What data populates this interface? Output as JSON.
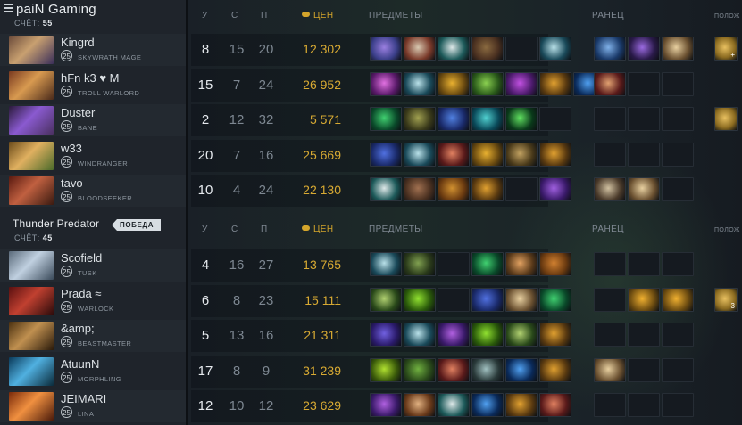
{
  "teams": [
    {
      "name": "paiN Gaming",
      "score_label": "СЧЁТ:",
      "score": "55",
      "victory_label": "",
      "headers": {
        "k": "У",
        "d": "С",
        "a": "П",
        "gold": "ЦЕН",
        "items": "ПРЕДМЕТЫ",
        "backpack": "РАНЕЦ",
        "neutral": "ПОЛОЖ"
      },
      "players": [
        {
          "name": "Kingrd",
          "level": "25",
          "hero": "SKYWRATH MAGE",
          "k": "8",
          "d": "15",
          "a": "20",
          "gold": "12 302",
          "portrait": [
            "#6a4a3a",
            "#c8a070",
            "#3b2f5a"
          ],
          "items": [
            [
              "#3b3f8a",
              "#9a7fe0"
            ],
            [
              "#7a3a2a",
              "#d8c8b0"
            ],
            [
              "#1d5a5a",
              "#dde8e8"
            ],
            [
              "#4a3020",
              "#8a6a40"
            ],
            null,
            [
              "#1a4a5a",
              "#b8e0e8"
            ]
          ],
          "backpack": [
            [
              "#1a3a6a",
              "#7fb0e8"
            ],
            [
              "#2a1a4a",
              "#9a6ae0"
            ],
            [
              "#6a5030",
              "#e8d0a0"
            ]
          ],
          "neutral": [
            "#8a6a20",
            "#e8c060"
          ],
          "neutral_plus": "+"
        },
        {
          "name": "hFn k3 ♥ M",
          "level": "25",
          "hero": "TROLL WARLORD",
          "k": "15",
          "d": "7",
          "a": "24",
          "gold": "26 952",
          "portrait": [
            "#7a3a20",
            "#d89a50",
            "#4a2a1a"
          ],
          "items": [
            [
              "#5a1a6a",
              "#e070e0"
            ],
            [
              "#1a4a5a",
              "#b8e0e8"
            ],
            [
              "#6a4a10",
              "#e8b030"
            ],
            [
              "#2a5a1a",
              "#8ad050"
            ],
            [
              "#4a1a6a",
              "#c050e0"
            ],
            [
              "#5a3a10",
              "#e0a030"
            ],
            [
              "#0a2a5a",
              "#50a0f0"
            ]
          ],
          "backpack": [
            [
              "#5a1a1a",
              "#e0a070"
            ],
            null,
            null
          ],
          "neutral": null,
          "neutral_plus": ""
        },
        {
          "name": "Duster",
          "level": "25",
          "hero": "BANE",
          "k": "2",
          "d": "12",
          "a": "32",
          "gold": "5 571",
          "portrait": [
            "#2a1a3a",
            "#8a5ad0",
            "#4a3060"
          ],
          "items": [
            [
              "#0a4a2a",
              "#40d070"
            ],
            [
              "#3a3a1a",
              "#a0a050"
            ],
            [
              "#1a2a6a",
              "#5080e0"
            ],
            [
              "#0a4a5a",
              "#50d0d0"
            ],
            [
              "#0a3a1a",
              "#60e060"
            ],
            null
          ],
          "backpack": [
            null,
            null,
            null
          ],
          "neutral": [
            "#8a6a20",
            "#e8c060"
          ],
          "neutral_plus": ""
        },
        {
          "name": "w33",
          "level": "25",
          "hero": "WINDRANGER",
          "k": "20",
          "d": "7",
          "a": "16",
          "gold": "25 669",
          "portrait": [
            "#6a4a1a",
            "#e0b060",
            "#4a6a2a"
          ],
          "items": [
            [
              "#1a2a6a",
              "#5070e0"
            ],
            [
              "#1a4a5a",
              "#b8e0e8"
            ],
            [
              "#5a1a1a",
              "#e08060"
            ],
            [
              "#6a4a10",
              "#e8b030"
            ],
            [
              "#4a3a1a",
              "#c0a060"
            ],
            [
              "#5a3a10",
              "#e0a030"
            ]
          ],
          "backpack": [
            null,
            null,
            null
          ],
          "neutral": null,
          "neutral_plus": ""
        },
        {
          "name": "tavo",
          "level": "25",
          "hero": "BLOODSEEKER",
          "k": "10",
          "d": "4",
          "a": "24",
          "gold": "22 130",
          "portrait": [
            "#5a1a10",
            "#c06040",
            "#3a1a10"
          ],
          "items": [
            [
              "#1d5a5a",
              "#dde8e8"
            ],
            [
              "#4a3020",
              "#a07050"
            ],
            [
              "#6a3a10",
              "#d09030"
            ],
            [
              "#5a3a10",
              "#e0a030"
            ],
            null,
            [
              "#3a1a6a",
              "#a060e0"
            ]
          ],
          "backpack": [
            [
              "#4a3a2a",
              "#d0c0a0"
            ],
            [
              "#6a5030",
              "#e8d0a0"
            ],
            null
          ],
          "neutral": null,
          "neutral_plus": ""
        }
      ]
    },
    {
      "name": "Thunder Predator",
      "score_label": "СЧЁТ:",
      "score": "45",
      "victory_label": "ПОБЕДА",
      "headers": {
        "k": "У",
        "d": "С",
        "a": "П",
        "gold": "ЦЕН",
        "items": "ПРЕДМЕТЫ",
        "backpack": "РАНЕЦ",
        "neutral": "ПОЛОЖ"
      },
      "players": [
        {
          "name": "Scofield",
          "level": "25",
          "hero": "TUSK",
          "k": "4",
          "d": "16",
          "a": "27",
          "gold": "13 765",
          "portrait": [
            "#5a6a7a",
            "#c0d0e0",
            "#3a4a5a"
          ],
          "items": [
            [
              "#1a4a5a",
              "#b8e0e8"
            ],
            [
              "#2a3a1a",
              "#80a050"
            ],
            null,
            [
              "#0a4a2a",
              "#40d070"
            ],
            [
              "#5a3a1a",
              "#e0a060"
            ],
            [
              "#6a3a10",
              "#d08030"
            ]
          ],
          "backpack": [
            null,
            null,
            null
          ],
          "neutral": null,
          "neutral_plus": ""
        },
        {
          "name": "Prada ≈",
          "level": "25",
          "hero": "WARLOCK",
          "k": "6",
          "d": "8",
          "a": "23",
          "gold": "15 111",
          "portrait": [
            "#5a1010",
            "#c04030",
            "#2a0a0a"
          ],
          "items": [
            [
              "#2a4a1a",
              "#b0d070"
            ],
            [
              "#2a5a0a",
              "#90e030"
            ],
            null,
            [
              "#1a2a6a",
              "#5070e0"
            ],
            [
              "#6a5030",
              "#e8d0a0"
            ],
            [
              "#0a4a2a",
              "#40d070"
            ]
          ],
          "backpack": [
            null,
            [
              "#6a4a10",
              "#f0b030"
            ],
            [
              "#6a4a10",
              "#f0b030"
            ]
          ],
          "neutral": [
            "#8a6a20",
            "#e8c060"
          ],
          "neutral_plus": "3"
        },
        {
          "name": "&amp;",
          "level": "25",
          "hero": "BEASTMASTER",
          "k": "5",
          "d": "13",
          "a": "16",
          "gold": "21 311",
          "portrait": [
            "#4a3010",
            "#c09050",
            "#2a1a0a"
          ],
          "items": [
            [
              "#2a1a6a",
              "#7060e0"
            ],
            [
              "#1a4a5a",
              "#b8e0e8"
            ],
            [
              "#3a1a6a",
              "#b060e0"
            ],
            [
              "#2a5a0a",
              "#90e030"
            ],
            [
              "#2a4a1a",
              "#b0d070"
            ],
            [
              "#5a3a10",
              "#e0a030"
            ]
          ],
          "backpack": [
            null,
            null,
            null
          ],
          "neutral": null,
          "neutral_plus": ""
        },
        {
          "name": "AtuunN",
          "level": "25",
          "hero": "MORPHLING",
          "k": "17",
          "d": "8",
          "a": "9",
          "gold": "31 239",
          "portrait": [
            "#0a3a5a",
            "#50b0e0",
            "#0a2a3a"
          ],
          "items": [
            [
              "#3a5a0a",
              "#b0e030"
            ],
            [
              "#2a4a1a",
              "#70b040"
            ],
            [
              "#5a1a1a",
              "#e08060"
            ],
            [
              "#2a3a3a",
              "#a0c0c0"
            ],
            [
              "#0a2a5a",
              "#50a0f0"
            ],
            [
              "#5a3a10",
              "#e0a030"
            ]
          ],
          "backpack": [
            [
              "#6a5030",
              "#e8d0a0"
            ],
            null,
            null
          ],
          "neutral": null,
          "neutral_plus": ""
        },
        {
          "name": "JEIMARI",
          "level": "25",
          "hero": "LINA",
          "k": "12",
          "d": "10",
          "a": "12",
          "gold": "23 629",
          "portrait": [
            "#7a2a0a",
            "#f09040",
            "#4a1a0a"
          ],
          "items": [
            [
              "#3a1a6a",
              "#b060e0"
            ],
            [
              "#6a3a1a",
              "#e0b080"
            ],
            [
              "#1d5a5a",
              "#dde8e8"
            ],
            [
              "#0a2a5a",
              "#50a0f0"
            ],
            [
              "#5a3a10",
              "#e0a030"
            ],
            [
              "#5a1a1a",
              "#e08060"
            ]
          ],
          "backpack": [
            null,
            null,
            null
          ],
          "neutral": null,
          "neutral_plus": ""
        }
      ]
    }
  ]
}
